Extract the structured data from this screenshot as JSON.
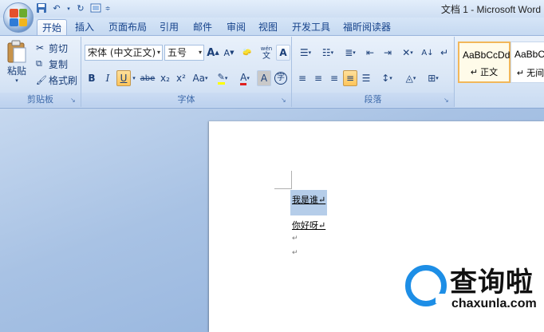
{
  "window": {
    "title": "文档 1 - Microsoft Word"
  },
  "tabs": [
    {
      "label": "开始",
      "active": true
    },
    {
      "label": "插入"
    },
    {
      "label": "页面布局"
    },
    {
      "label": "引用"
    },
    {
      "label": "邮件"
    },
    {
      "label": "审阅"
    },
    {
      "label": "视图"
    },
    {
      "label": "开发工具"
    },
    {
      "label": "福昕阅读器"
    }
  ],
  "ribbon": {
    "clipboard": {
      "label": "剪贴板",
      "paste": "粘贴",
      "cut": "剪切",
      "copy": "复制",
      "format_painter": "格式刷"
    },
    "font": {
      "label": "字体",
      "font_name": "宋体 (中文正文)",
      "font_size": "五号",
      "bold": "B",
      "italic": "I",
      "underline": "U",
      "strike": "abe",
      "subscript": "x₂",
      "superscript": "x²",
      "change_case": "Aa",
      "grow": "A",
      "shrink": "A",
      "char_border": "A",
      "char_shading": "A",
      "enclose": "字",
      "phonetic": "wén"
    },
    "paragraph": {
      "label": "段落"
    },
    "styles": {
      "items": [
        {
          "sample": "AaBbCcDdI",
          "name": "↵ 正文"
        },
        {
          "sample": "AaBbCc",
          "name": "↵ 无间"
        }
      ]
    }
  },
  "document": {
    "lines": [
      "我是谁↵",
      "你好呀↵",
      "↵",
      "↵"
    ]
  },
  "watermark": {
    "cn": "查询啦",
    "en": "chaxunla.com"
  },
  "colors": {
    "accent": "#1d8ee6",
    "selection": "#b5cde9",
    "ribbon": "#dbe7f6"
  }
}
